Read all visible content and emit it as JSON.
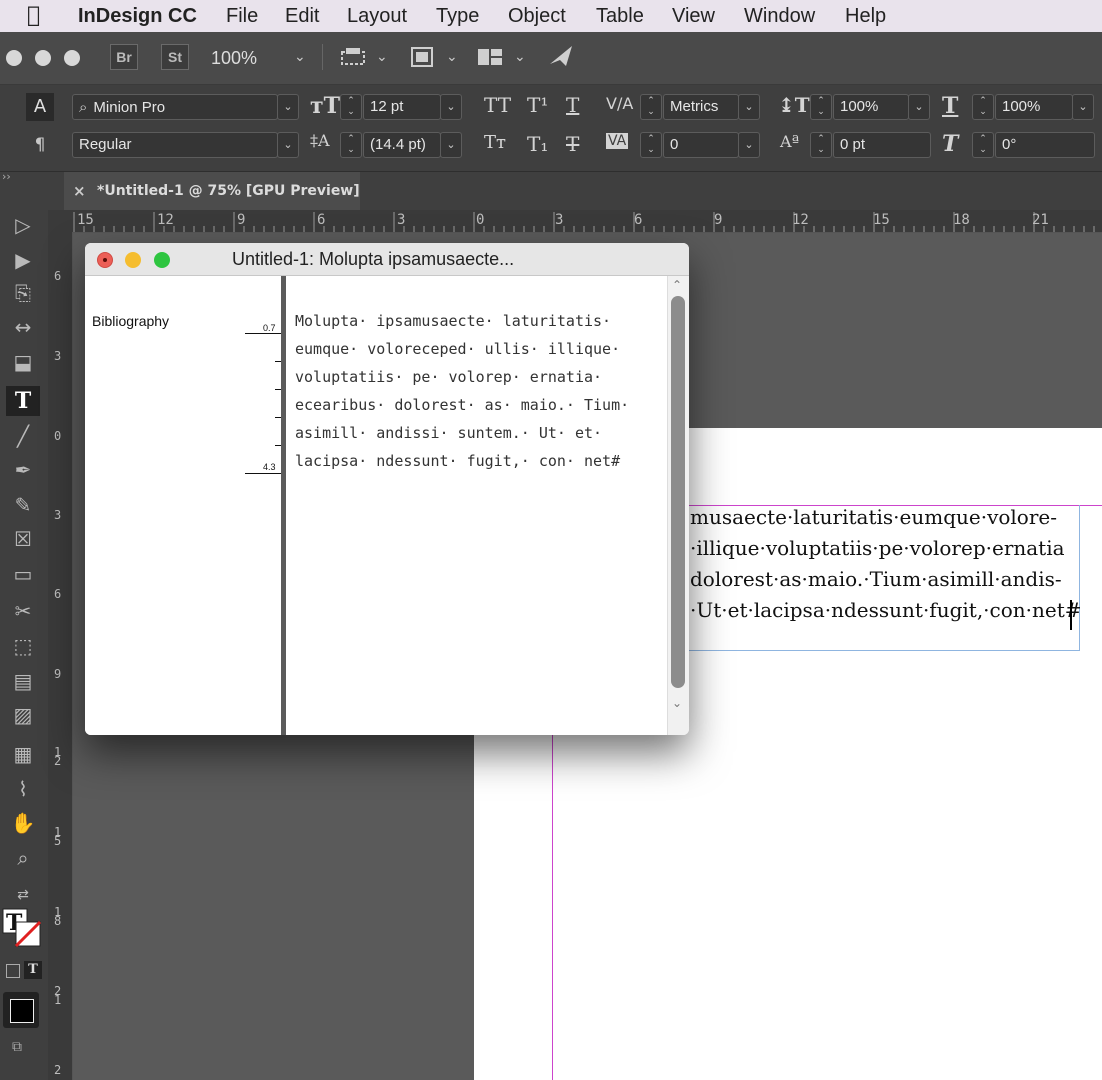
{
  "menubar": {
    "app_name": "InDesign CC",
    "items": [
      "File",
      "Edit",
      "Layout",
      "Type",
      "Object",
      "Table",
      "View",
      "Window",
      "Help"
    ]
  },
  "appbar": {
    "bridge_label": "Br",
    "stock_label": "St",
    "zoom": "100%"
  },
  "control_panel": {
    "font_family": "Minion Pro",
    "font_style": "Regular",
    "font_size": "12 pt",
    "leading": "(14.4 pt)",
    "kerning": "Metrics",
    "tracking": "0",
    "vertical_scale": "100%",
    "horizontal_scale": "100%",
    "baseline_shift": "0 pt",
    "skew": "0°",
    "char_label": "A",
    "para_label": "¶"
  },
  "document_tab": {
    "title": "*Untitled-1 @ 75% [GPU Preview]",
    "close": "×"
  },
  "rulers": {
    "horizontal": [
      "15",
      "12",
      "9",
      "6",
      "3",
      "0",
      "3",
      "6",
      "9",
      "12",
      "15",
      "18",
      "21"
    ],
    "vertical": [
      "6",
      "3",
      "0",
      "3",
      "6",
      "9",
      "12",
      "15",
      "18",
      "21",
      "2"
    ]
  },
  "page_text": {
    "lines": [
      "musaecte·laturitatis·eumque·volore-",
      "·illique·voluptatiis·pe·volorep·ernatia",
      "dolorest·as·maio.·Tium·asimill·andis-",
      "·Ut·et·lacipsa·ndessunt·fugit,·con·net#"
    ]
  },
  "story_editor": {
    "title": "Untitled-1: Molupta ipsamusaecte...",
    "style_name": "Bibliography",
    "depth_top": "0.7",
    "depth_bottom": "4.3",
    "lines": [
      "Molupta· ipsamusaecte· laturitatis·",
      "eumque· voloreceped· ullis· illique·",
      "voluptatiis· pe· volorep· ernatia·",
      "ecearibus· dolorest· as· maio.· Tium·",
      "asimill· andissi· suntem.· Ut· et·",
      "lacipsa· ndessunt· fugit,· con· net#"
    ]
  },
  "colors": {
    "menubar_bg": "#e9e3ec",
    "panel_bg": "#3f3f3f",
    "pasteboard": "#5a5a5a",
    "margin_guide": "#cc44cc",
    "frame_edge": "#8fb5e0"
  }
}
